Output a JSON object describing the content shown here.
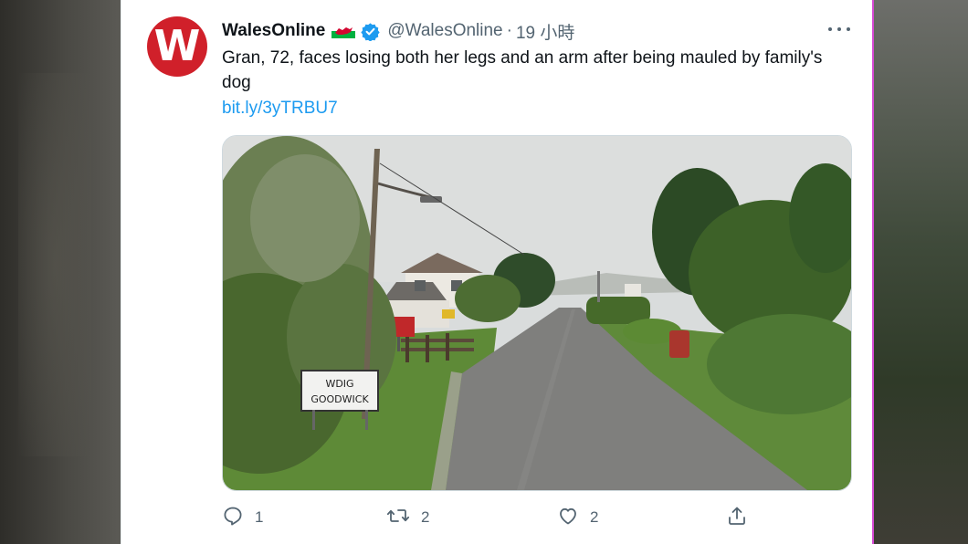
{
  "tweet": {
    "display_name": "WalesOnline",
    "avatar_letter": "W",
    "handle": "@WalesOnline",
    "separator": "·",
    "time": "19 小時",
    "text": "Gran, 72, faces losing both her legs and an arm after being mauled by family's dog",
    "link": "bit.ly/3yTRBU7"
  },
  "media": {
    "sign_line1": "WDIG",
    "sign_line2": "GOODWICK"
  },
  "actions": {
    "reply_count": "1",
    "retweet_count": "2",
    "like_count": "2"
  },
  "icons": {
    "flag": "wales-flag-icon",
    "verified": "verified-badge-icon",
    "more": "more-icon",
    "reply": "reply-icon",
    "retweet": "retweet-icon",
    "like": "heart-icon",
    "share": "share-icon"
  },
  "colors": {
    "accent": "#1d9bf0",
    "brand": "#d0202a",
    "text": "#0f1419",
    "muted": "#536471"
  }
}
